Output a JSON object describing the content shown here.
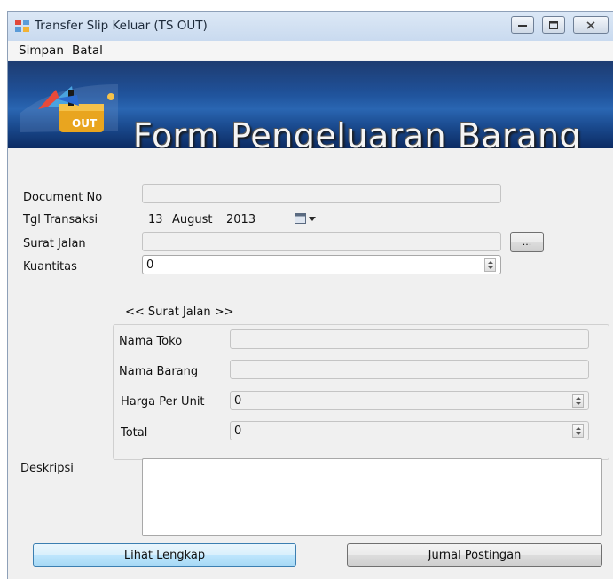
{
  "window": {
    "title": "Transfer Slip Keluar (TS OUT)",
    "controls": [
      "minimize-icon",
      "maximize-icon",
      "close-icon"
    ]
  },
  "menu": {
    "items": [
      "Simpan",
      "Batal"
    ]
  },
  "banner": {
    "title": "Form Pengeluaran Barang",
    "badge": "OUT"
  },
  "form": {
    "document_no": {
      "label": "Document No",
      "value": ""
    },
    "tgl_transaksi": {
      "label": "Tgl Transaksi",
      "day": "13",
      "month": "August",
      "year": "2013"
    },
    "surat_jalan": {
      "label": "Surat Jalan",
      "value": "",
      "browse_label": "..."
    },
    "kuantitas": {
      "label": "Kuantitas",
      "value": "0"
    },
    "group": {
      "title": "<< Surat Jalan >>",
      "nama_toko": {
        "label": "Nama Toko",
        "value": ""
      },
      "nama_barang": {
        "label": "Nama Barang",
        "value": ""
      },
      "harga_per_unit": {
        "label": "Harga Per Unit",
        "value": "0"
      },
      "total": {
        "label": "Total",
        "value": "0"
      }
    },
    "deskripsi": {
      "label": "Deskripsi",
      "value": ""
    }
  },
  "buttons": {
    "lihat_lengkap": "Lihat Lengkap",
    "jurnal_postingan": "Jurnal Postingan"
  }
}
